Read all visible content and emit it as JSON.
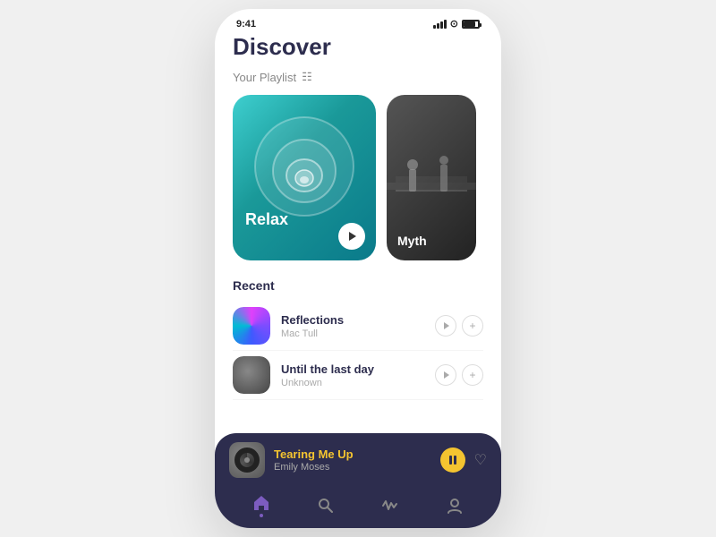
{
  "statusBar": {
    "time": "9:41",
    "icons": [
      "signal",
      "wifi",
      "battery"
    ]
  },
  "header": {
    "title": "Discover"
  },
  "playlist": {
    "label": "Your Playlist",
    "cards": [
      {
        "id": "relax",
        "name": "Relax",
        "type": "teal"
      },
      {
        "id": "myth",
        "name": "Myth",
        "type": "dark"
      }
    ]
  },
  "recent": {
    "label": "Recent",
    "tracks": [
      {
        "id": "reflections",
        "title": "Reflections",
        "artist": "Mac Tull",
        "artwork": "reflections"
      },
      {
        "id": "until",
        "title": "Until the last day",
        "artist": "Unknown",
        "artwork": "until"
      }
    ]
  },
  "nowPlaying": {
    "title": "Tearing Me Up",
    "artist": "Emily Moses"
  },
  "nav": {
    "items": [
      {
        "id": "home",
        "icon": "⌂",
        "active": true
      },
      {
        "id": "search",
        "icon": "⌕",
        "active": false
      },
      {
        "id": "wave",
        "icon": "〜",
        "active": false
      },
      {
        "id": "profile",
        "icon": "⊙",
        "active": false
      }
    ]
  }
}
